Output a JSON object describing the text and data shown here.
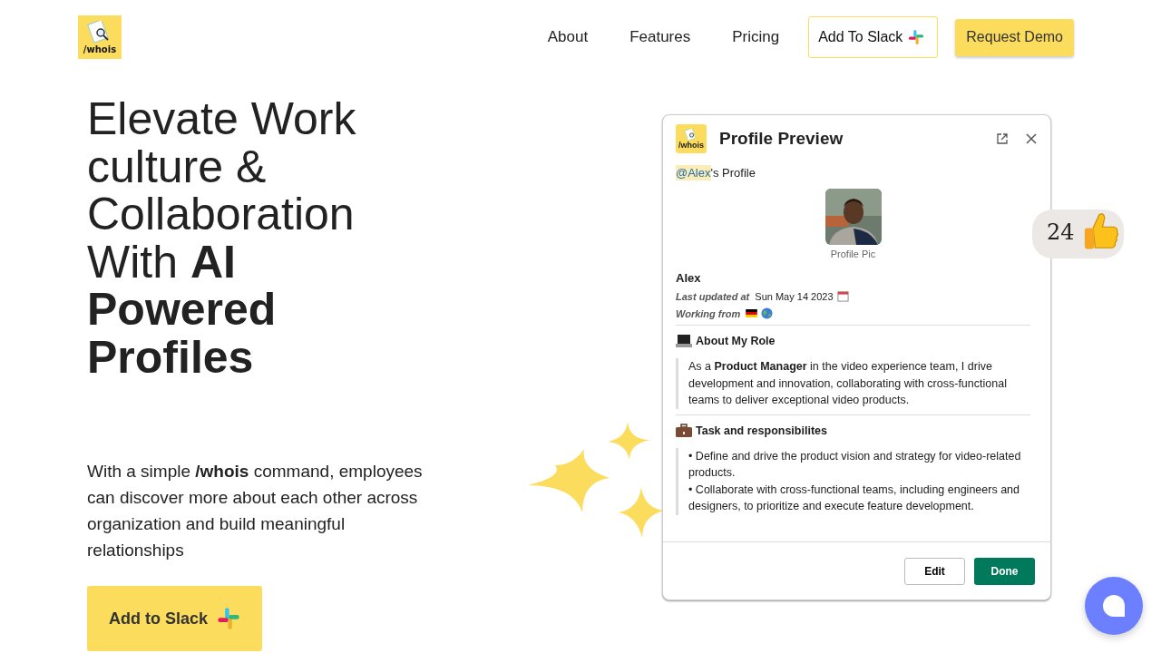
{
  "header": {
    "logo_text": "/whois",
    "nav": [
      "About",
      "Features",
      "Pricing"
    ],
    "add_to_slack": "Add To Slack",
    "request_demo": "Request Demo"
  },
  "hero": {
    "title_lines": [
      "Elevate Work",
      "culture &",
      "Collaboration",
      "With **AI**",
      "**Powered**",
      "**Profiles**"
    ],
    "description": "With a simple **/whois** command, employees can discover more about each other across organization and build meaningful relationships",
    "cta": "Add to Slack"
  },
  "preview": {
    "logo_text": "/whois",
    "title": "Profile Preview",
    "mention": "@Alex",
    "mention_suffix": "'s Profile",
    "pic_caption": "Profile Pic",
    "name": "Alex",
    "updated_label": "Last updated at",
    "updated_value": "Sun May 14 2023",
    "working_label": "Working from",
    "sections": [
      {
        "title": "About My Role",
        "lines": [
          "As a **Product Manager** in the video experience team, I drive development and innovation, collaborating with cross-functional teams to deliver exceptional video products."
        ]
      },
      {
        "title": "Task and responsibilites",
        "lines": [
          "• Define and drive the product vision and strategy for video-related products.",
          "• Collaborate with cross-functional teams, including engineers and designers, to prioritize and execute feature development."
        ]
      }
    ],
    "edit": "Edit",
    "done": "Done"
  },
  "reaction": {
    "count": "24"
  }
}
